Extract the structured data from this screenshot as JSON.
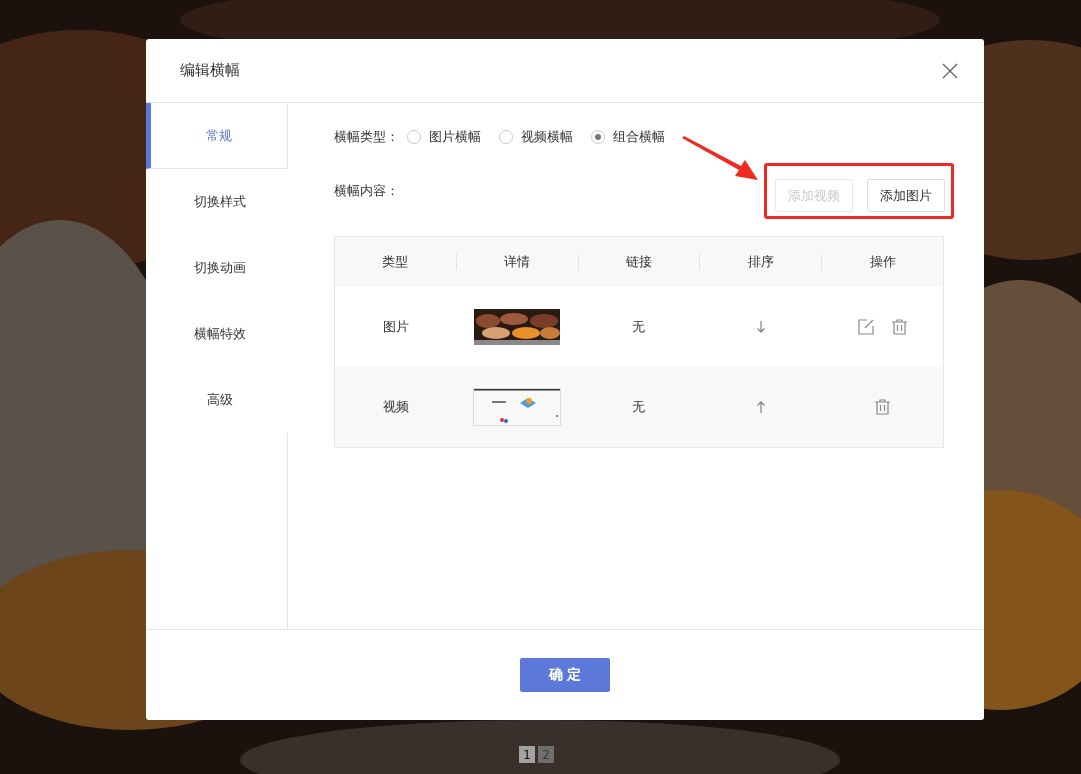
{
  "dialog": {
    "title": "编辑横幅",
    "confirm_button": "确 定"
  },
  "sidebar": {
    "items": [
      {
        "label": "常规",
        "selected": true
      },
      {
        "label": "切换样式",
        "selected": false
      },
      {
        "label": "切换动画",
        "selected": false
      },
      {
        "label": "横幅特效",
        "selected": false
      },
      {
        "label": "高级",
        "selected": false
      }
    ]
  },
  "banner_type": {
    "label": "横幅类型：",
    "options": [
      {
        "label": "图片横幅",
        "selected": false
      },
      {
        "label": "视频横幅",
        "selected": false
      },
      {
        "label": "组合横幅",
        "selected": true
      }
    ]
  },
  "banner_content": {
    "label": "横幅内容：",
    "buttons": [
      {
        "label": "添加视频",
        "disabled": true
      },
      {
        "label": "添加图片",
        "disabled": false
      }
    ]
  },
  "table": {
    "columns": [
      "类型",
      "详情",
      "链接",
      "排序",
      "操作"
    ],
    "rows": [
      {
        "type": "图片",
        "link": "无",
        "sort_down": true,
        "editable": true
      },
      {
        "type": "视频",
        "link": "无",
        "sort_down": false,
        "editable": false
      }
    ]
  },
  "pagination": [
    {
      "label": "1",
      "selected": true
    },
    {
      "label": "2",
      "selected": false
    }
  ]
}
